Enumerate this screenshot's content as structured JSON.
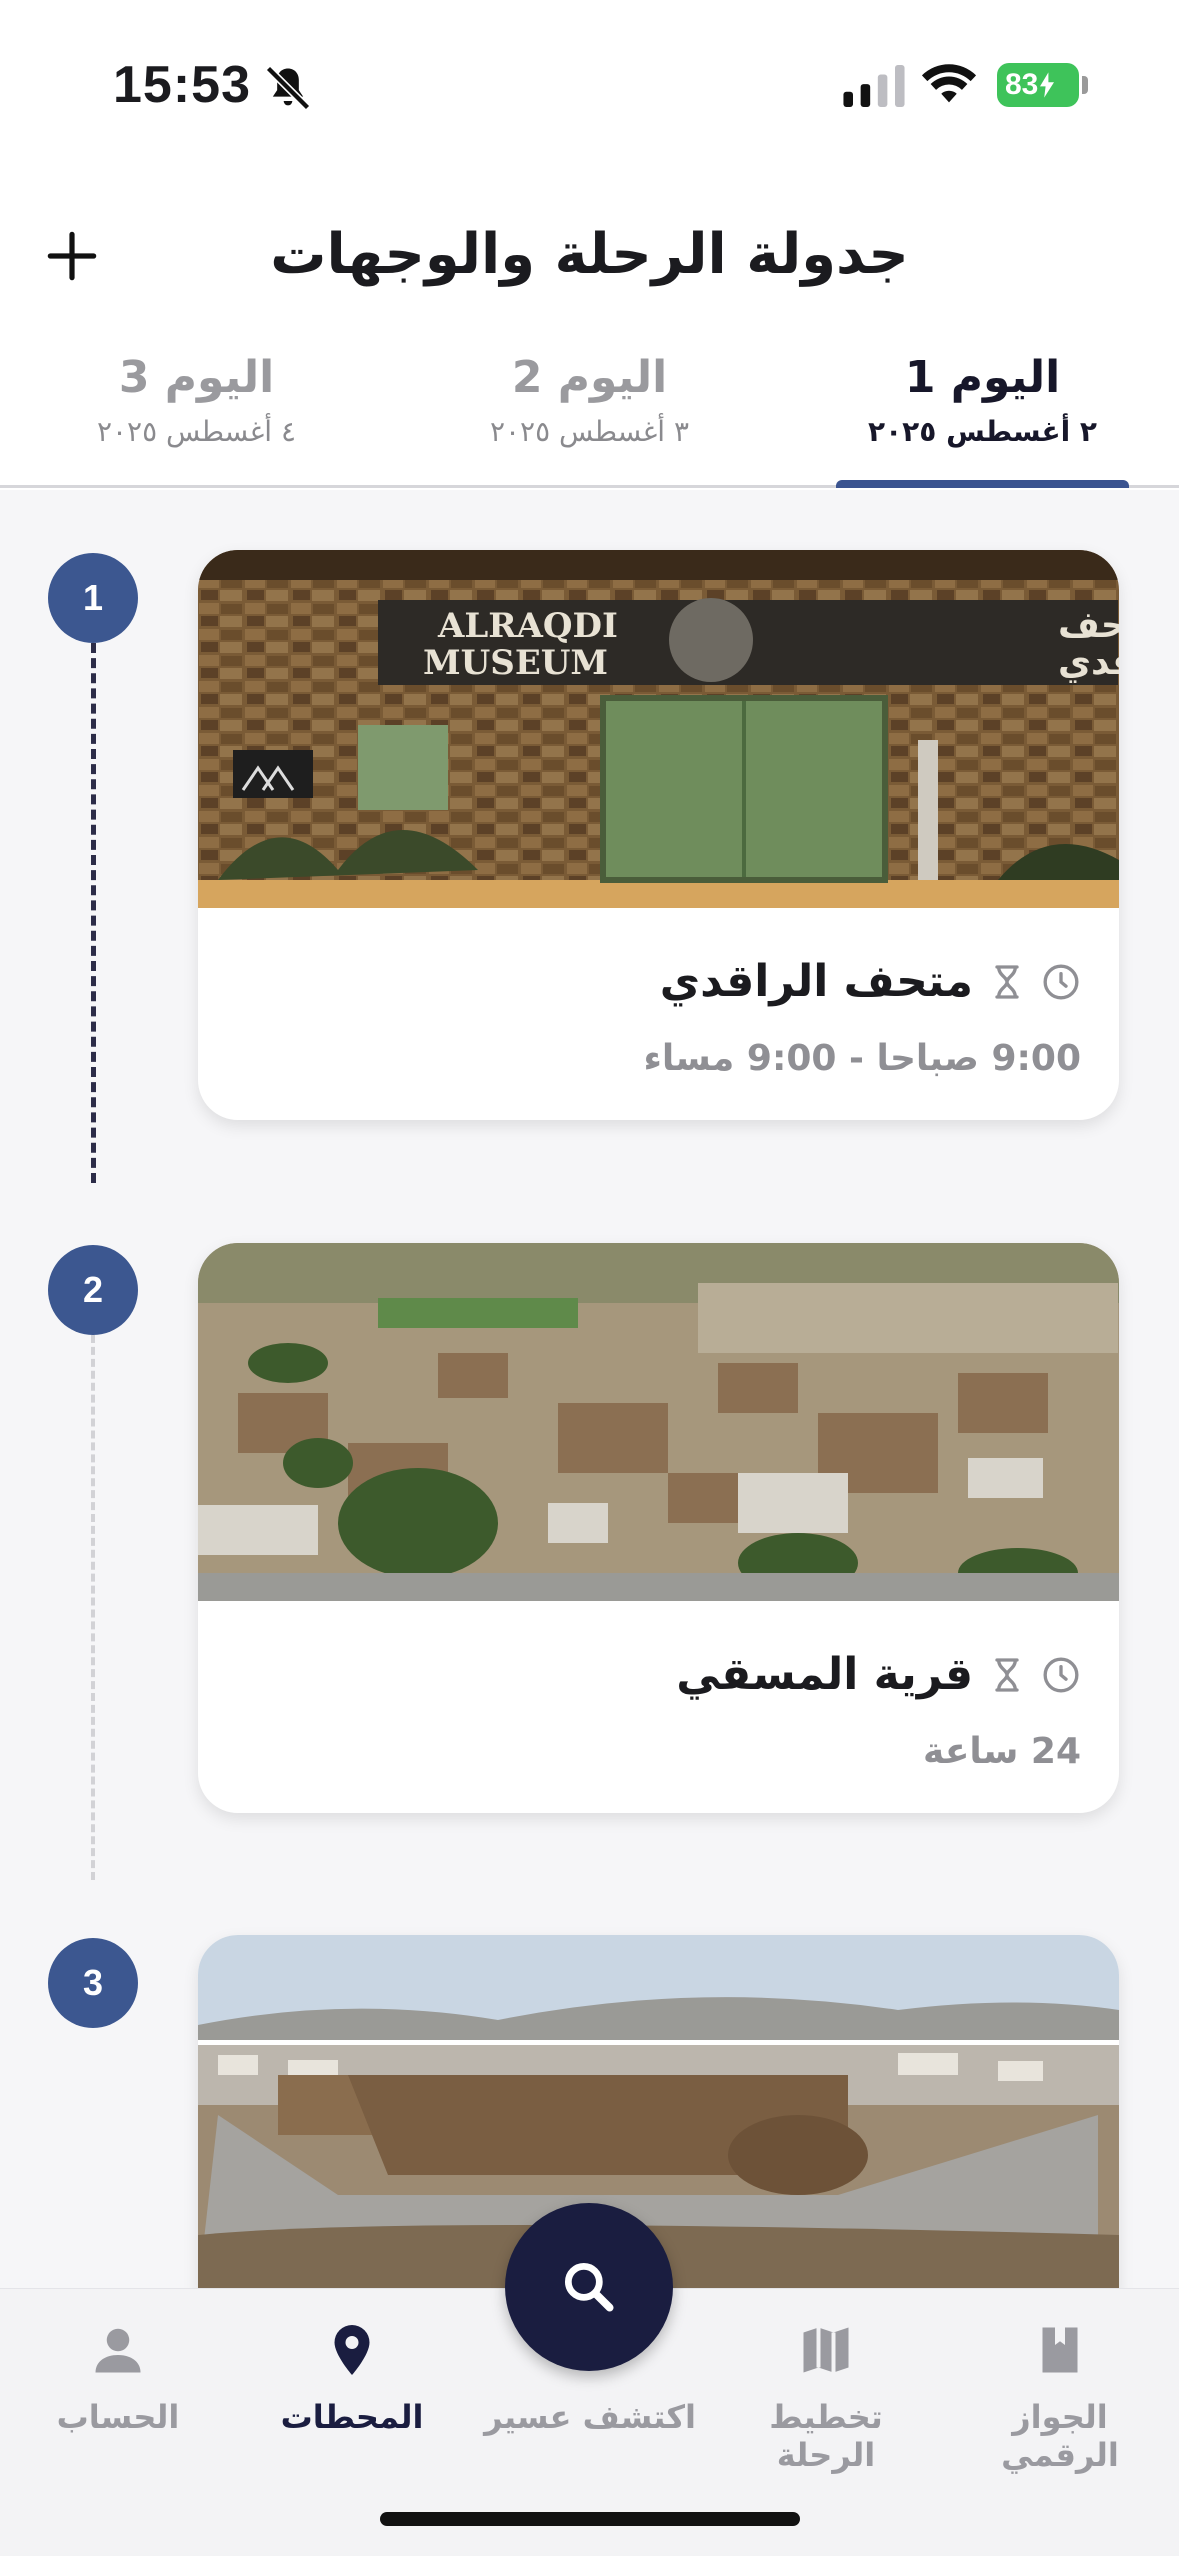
{
  "status_bar": {
    "time": "15:53",
    "battery": "83"
  },
  "header": {
    "title": "جدولة الرحلة والوجهات",
    "add_icon": "plus-icon"
  },
  "tabs": [
    {
      "label": "اليوم 1",
      "date": "٢ أغسطس ٢٠٢٥",
      "active": true
    },
    {
      "label": "اليوم 2",
      "date": "٣ أغسطس ٢٠٢٥",
      "active": false
    },
    {
      "label": "اليوم 3",
      "date": "٤ أغسطس ٢٠٢٥",
      "active": false
    }
  ],
  "stops": [
    {
      "number": "1",
      "title": "متحف الراقدي",
      "hours": "9:00 صباحا - 9:00 مساء",
      "sign_left": "ALRAQDI",
      "sign_left2": "MUSEUM",
      "sign_right": "متحف",
      "sign_right2": "الراقدي"
    },
    {
      "number": "2",
      "title": "قرية المسقي",
      "hours": "24 ساعة"
    },
    {
      "number": "3"
    }
  ],
  "bottom_nav": {
    "items": [
      {
        "label": "الجواز الرقمي",
        "icon": "book-icon"
      },
      {
        "label": "تخطيط الرحلة",
        "icon": "map-icon"
      },
      {
        "label": "اكتشف عسير",
        "icon": "search-icon"
      },
      {
        "label": "المحطات",
        "icon": "location-pin-icon"
      },
      {
        "label": "الحساب",
        "icon": "person-icon"
      }
    ],
    "active_index": 3
  },
  "colors": {
    "accent": "#3b5490",
    "nav_dark": "#1a1d40",
    "battery": "#3ec35a"
  }
}
